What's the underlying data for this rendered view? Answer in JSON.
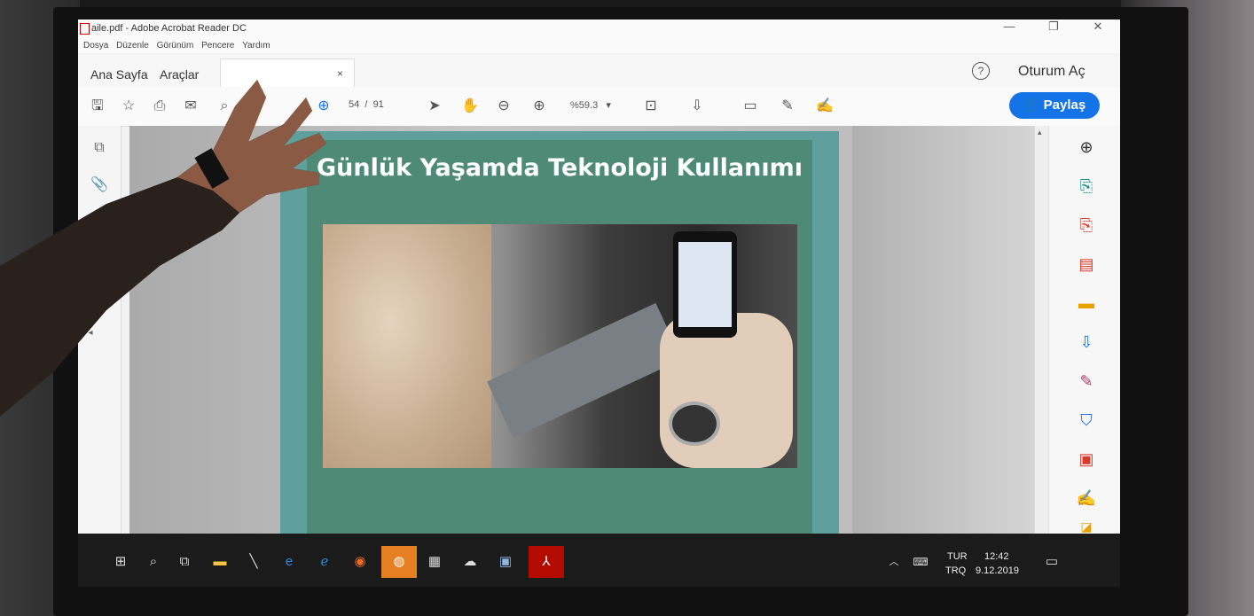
{
  "window": {
    "title": "aile.pdf - Adobe Acrobat Reader DC"
  },
  "menu": [
    "Dosya",
    "Düzenle",
    "Görünüm",
    "Pencere",
    "Yardım"
  ],
  "tabs": {
    "home": "Ana Sayfa",
    "tools": "Araçlar",
    "close": "×"
  },
  "header": {
    "help": "?",
    "signin": "Oturum Aç"
  },
  "toolbar": {
    "page_current": "54",
    "page_sep": "/",
    "page_total": "91",
    "zoom": "%59.3",
    "share": "Paylaş"
  },
  "slide": {
    "title": "Günlük Yaşamda Teknoloji Kullanımı"
  },
  "taskbar": {
    "lang_top": "TUR",
    "lang_bottom": "TRQ",
    "time": "12:42",
    "date": "9.12.2019"
  },
  "colors": {
    "accent": "#1473e6",
    "slide_bg": "#4f8a76",
    "slide_frame": "#5f9f9c"
  }
}
